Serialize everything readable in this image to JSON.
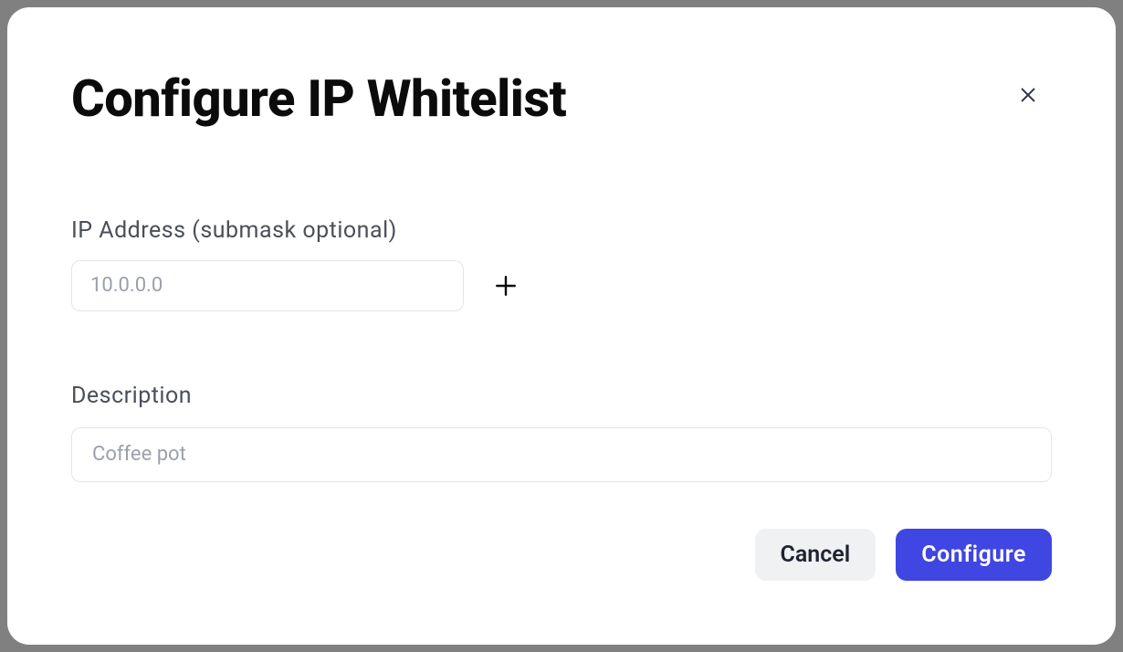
{
  "modal": {
    "title": "Configure IP Whitelist",
    "fields": {
      "ip": {
        "label": "IP Address (submask optional)",
        "placeholder": "10.0.0.0",
        "value": ""
      },
      "description": {
        "label": "Description",
        "placeholder": "Coffee pot",
        "value": ""
      }
    },
    "buttons": {
      "cancel": "Cancel",
      "confirm": "Configure"
    }
  }
}
